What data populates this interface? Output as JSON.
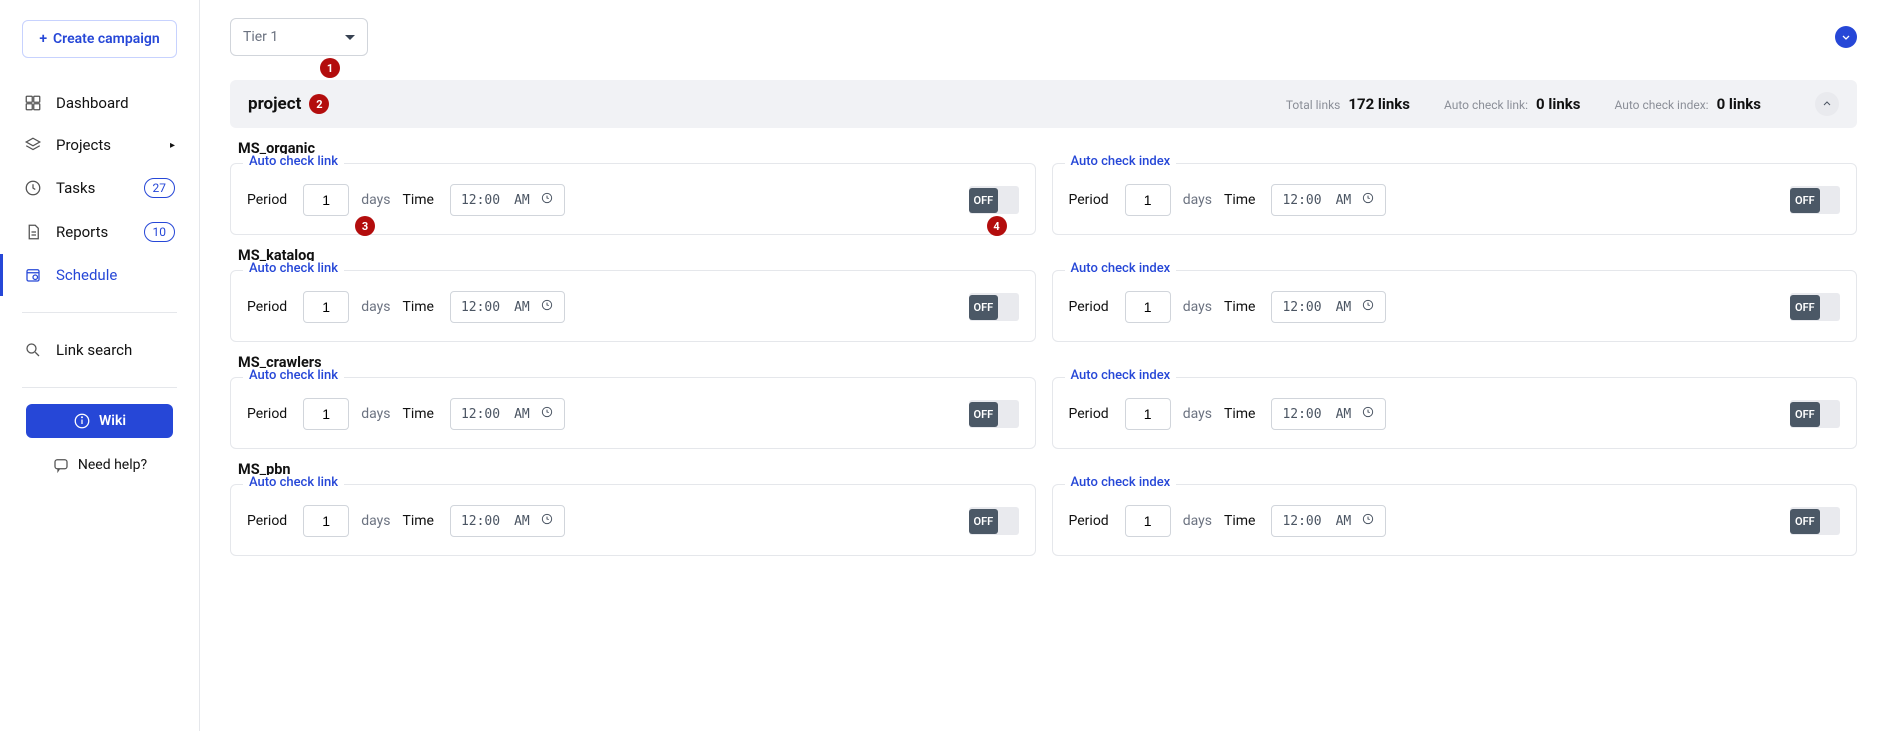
{
  "sidebar": {
    "create_label": "Create campaign",
    "items": {
      "dashboard": "Dashboard",
      "projects": "Projects",
      "tasks": "Tasks",
      "tasks_count": "27",
      "reports": "Reports",
      "reports_count": "10",
      "schedule": "Schedule",
      "link_search": "Link search"
    },
    "wiki_label": "Wiki",
    "help_label": "Need help?"
  },
  "tier": {
    "selected": "Tier 1"
  },
  "project": {
    "name": "project",
    "total_links_label": "Total links",
    "total_links_value": "172 links",
    "auto_check_link_label": "Auto check link:",
    "auto_check_link_value": "0 links",
    "auto_check_index_label": "Auto check index:",
    "auto_check_index_value": "0 links"
  },
  "labels": {
    "auto_check_link": "Auto check link",
    "auto_check_index": "Auto check index",
    "period": "Period",
    "days": "days",
    "time": "Time",
    "time_value": "12:00",
    "ampm": "AM",
    "toggle_off": "OFF"
  },
  "sections": {
    "s1": {
      "title": "MS_organic",
      "period": "1"
    },
    "s2": {
      "title": "MS_katalog",
      "period": "1"
    },
    "s3": {
      "title": "MS_crawlers",
      "period": "1"
    },
    "s4": {
      "title": "MS_pbn",
      "period": "1"
    }
  },
  "annotations": {
    "a1": "1",
    "a2": "2",
    "a3": "3",
    "a4": "4"
  }
}
